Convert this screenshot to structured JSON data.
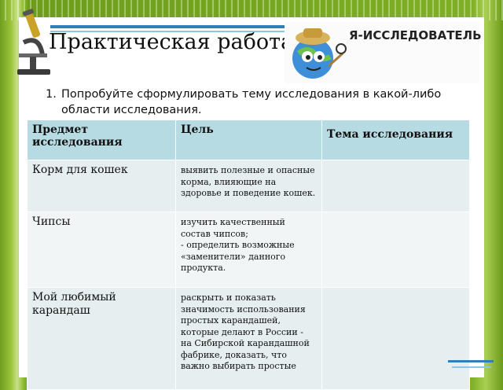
{
  "slide": {
    "title": "Практическая работа",
    "logo_text": "Я-ИССЛЕДОВАТЕЛЬ",
    "task": {
      "number": "1.",
      "text": "Попробуйте сформулировать тему исследования в какой-либо области исследования."
    }
  },
  "table": {
    "headers": [
      "Предмет исследования",
      "Цель",
      "Тема исследования"
    ],
    "rows": [
      {
        "subject": "Корм для кошек",
        "goal": "выявить полезные и опасные корма, влияющие на здоровье и поведение кошек.",
        "topic": ""
      },
      {
        "subject": "Чипсы",
        "goal": "изучить качественный состав чипсов;\n- определить возможные «заменители» данного продукта.",
        "topic": ""
      },
      {
        "subject": "Мой любимый карандаш",
        "goal": "раскрыть и показать значимость использования простых карандашей, которые делают в России - на Сибирской карандашной фабрике, доказать, что важно выбирать простые",
        "topic": ""
      }
    ]
  },
  "colors": {
    "header_bg": "#b7dbe3",
    "row_bg": "#e6eef0",
    "frame_green": "#7fae27",
    "accent_blue": "#2d7fc0"
  }
}
